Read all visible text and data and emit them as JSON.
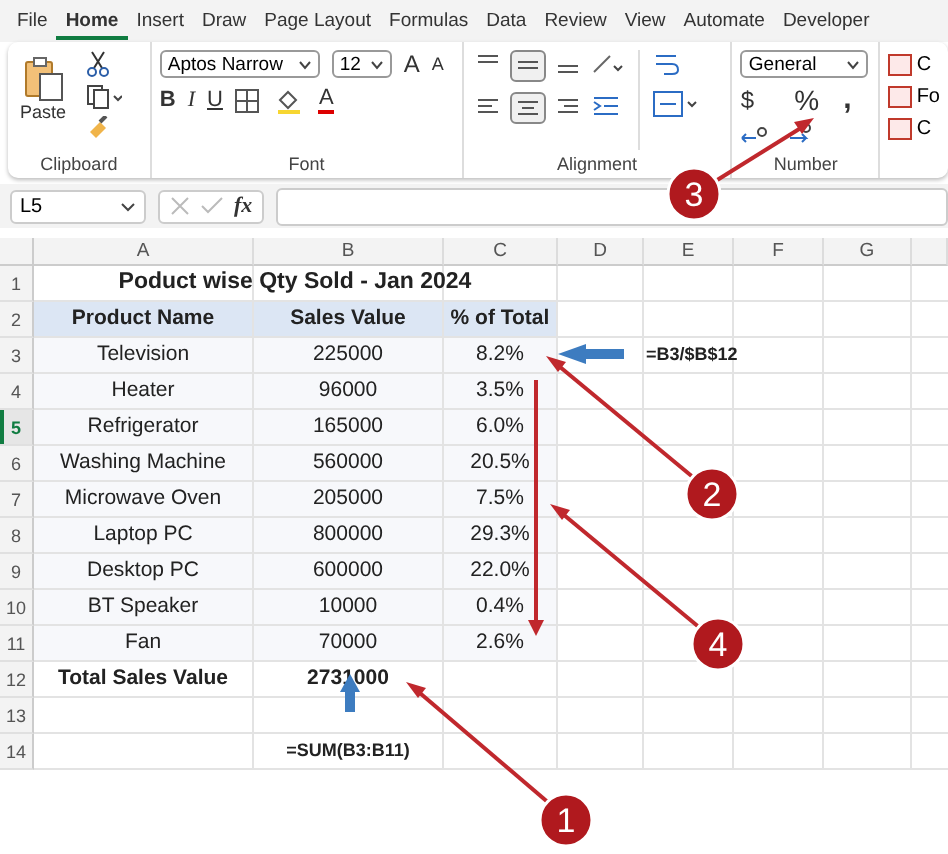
{
  "menu_tabs": [
    {
      "label": "File",
      "selected": false
    },
    {
      "label": "Home",
      "selected": true
    },
    {
      "label": "Insert",
      "selected": false
    },
    {
      "label": "Draw",
      "selected": false
    },
    {
      "label": "Page Layout",
      "selected": false
    },
    {
      "label": "Formulas",
      "selected": false
    },
    {
      "label": "Data",
      "selected": false
    },
    {
      "label": "Review",
      "selected": false
    },
    {
      "label": "View",
      "selected": false
    },
    {
      "label": "Automate",
      "selected": false
    },
    {
      "label": "Developer",
      "selected": false
    }
  ],
  "ribbon": {
    "clipboard": {
      "paste": "Paste",
      "label": "Clipboard"
    },
    "font": {
      "name": "Aptos Narrow",
      "size": "12",
      "grow": "A",
      "shrink": "A",
      "bold": "B",
      "italic": "I",
      "underline": "U",
      "text_color_button": "A",
      "label": "Font"
    },
    "alignment": {
      "label": "Alignment"
    },
    "number": {
      "format": "General",
      "currency": "$",
      "percent": "%",
      "comma": ",",
      "label": "Number"
    },
    "styles": {
      "items": [
        "C",
        "Fo",
        "C"
      ]
    }
  },
  "formula_bar": {
    "name_box": "L5",
    "fx": "fx"
  },
  "sheet": {
    "columns": [
      "A",
      "B",
      "C",
      "D",
      "E",
      "F",
      "G"
    ],
    "row_headers": [
      {
        "label": "1",
        "selected": false
      },
      {
        "label": "2",
        "selected": false
      },
      {
        "label": "3",
        "selected": false
      },
      {
        "label": "4",
        "selected": false
      },
      {
        "label": "5",
        "selected": true
      },
      {
        "label": "6",
        "selected": false
      },
      {
        "label": "7",
        "selected": false
      },
      {
        "label": "8",
        "selected": false
      },
      {
        "label": "9",
        "selected": false
      },
      {
        "label": "10",
        "selected": false
      },
      {
        "label": "11",
        "selected": false
      },
      {
        "label": "12",
        "selected": false
      },
      {
        "label": "13",
        "selected": false
      },
      {
        "label": "14",
        "selected": false
      }
    ],
    "title": "Poduct wise Qty Sold - Jan 2024",
    "headers": [
      "Product Name",
      "Sales Value",
      "% of Total"
    ],
    "rows": [
      {
        "product": "Television",
        "sales": "225000",
        "percent": "8.2%"
      },
      {
        "product": "Heater",
        "sales": "96000",
        "percent": "3.5%"
      },
      {
        "product": "Refrigerator",
        "sales": "165000",
        "percent": "6.0%"
      },
      {
        "product": "Washing Machine",
        "sales": "560000",
        "percent": "20.5%"
      },
      {
        "product": "Microwave Oven",
        "sales": "205000",
        "percent": "7.5%"
      },
      {
        "product": "Laptop PC",
        "sales": "800000",
        "percent": "29.3%"
      },
      {
        "product": "Desktop PC",
        "sales": "600000",
        "percent": "22.0%"
      },
      {
        "product": "BT Speaker",
        "sales": "10000",
        "percent": "0.4%"
      },
      {
        "product": "Fan",
        "sales": "70000",
        "percent": "2.6%"
      }
    ],
    "total": {
      "label": "Total Sales Value",
      "value": "2731000"
    },
    "percent_formula": "=B3/$B$12",
    "sum_formula": "=SUM(B3:B11)"
  },
  "callouts": [
    "1",
    "2",
    "3",
    "4"
  ]
}
